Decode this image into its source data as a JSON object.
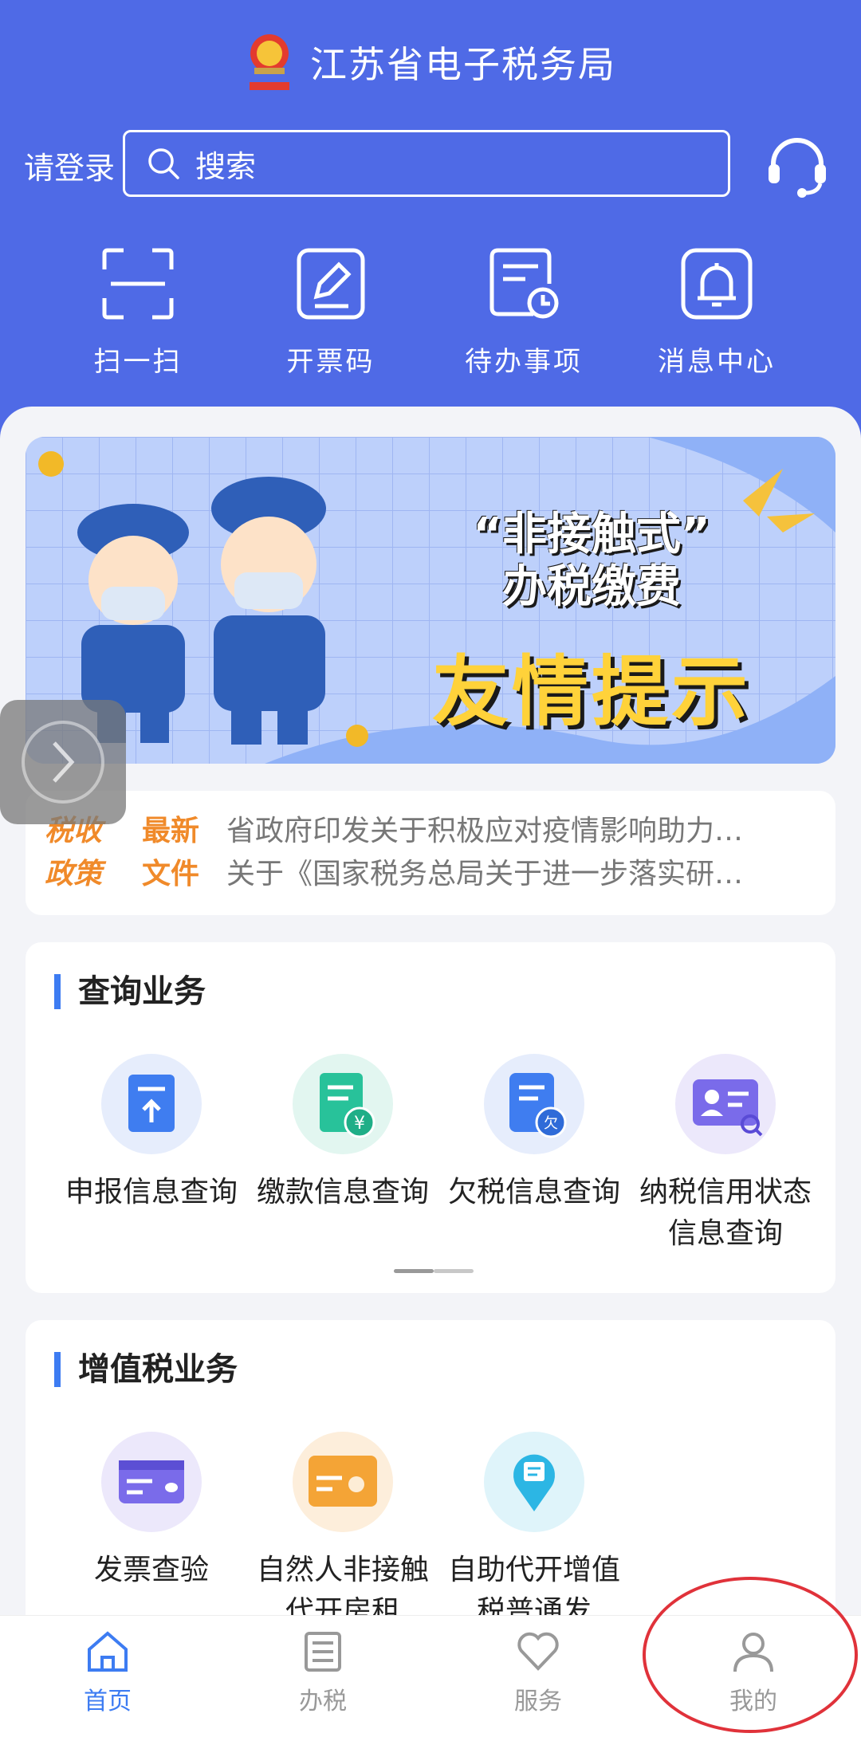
{
  "header": {
    "title": "江苏省电子税务局",
    "login_label": "请登录",
    "search": {
      "placeholder": "搜索"
    },
    "quick_actions": [
      {
        "label": "扫一扫",
        "icon": "scan-icon"
      },
      {
        "label": "开票码",
        "icon": "edit-icon"
      },
      {
        "label": "待办事项",
        "icon": "todo-clock-icon"
      },
      {
        "label": "消息中心",
        "icon": "bell-icon"
      }
    ]
  },
  "banner": {
    "line1": "“非接触式”",
    "line2": "办税缴费",
    "line3": "友情提示"
  },
  "news": {
    "logo_line1": "税收",
    "logo_line2": "政策",
    "tag_line1": "最新",
    "tag_line2": "文件",
    "items": [
      "省政府印发关于积极应对疫情影响助力…",
      "关于《国家税务总局关于进一步落实研…"
    ]
  },
  "query_section": {
    "title": "查询业务",
    "items": [
      {
        "label": "申报信息查询",
        "icon": "declare-query-icon"
      },
      {
        "label": "缴款信息查询",
        "icon": "payment-query-icon"
      },
      {
        "label": "欠税信息查询",
        "icon": "arrears-query-icon"
      },
      {
        "label": "纳税信用状态信息查询",
        "icon": "credit-query-icon"
      }
    ]
  },
  "vat_section": {
    "title": "增值税业务",
    "items": [
      {
        "label": "发票查验",
        "icon": "invoice-check-icon"
      },
      {
        "label": "自然人非接触代开房租",
        "icon": "rent-invoice-icon"
      },
      {
        "label": "自助代开增值税普通发",
        "icon": "self-invoice-icon"
      }
    ]
  },
  "tabbar": {
    "tabs": [
      {
        "label": "首页",
        "icon": "home-icon",
        "active": true
      },
      {
        "label": "办税",
        "icon": "list-icon",
        "active": false
      },
      {
        "label": "服务",
        "icon": "heart-icon",
        "active": false
      },
      {
        "label": "我的",
        "icon": "user-icon",
        "active": false
      }
    ]
  },
  "colors": {
    "header_bg": "#4f6ae6",
    "accent": "#3d7cf2",
    "news_orange": "#f08a2a",
    "annotation_red": "#e0323a"
  }
}
